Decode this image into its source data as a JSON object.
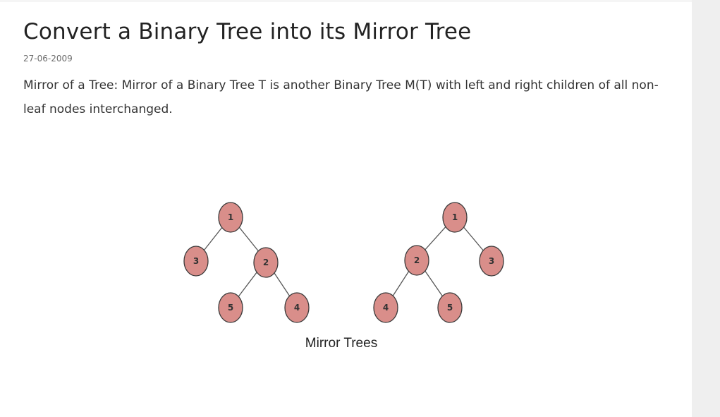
{
  "article": {
    "title": "Convert a Binary Tree into its Mirror Tree",
    "date": "27-06-2009",
    "description": "Mirror of a Tree: Mirror of a Binary Tree T is another Binary Tree M(T) with left and right children of all non-leaf nodes interchanged."
  },
  "figure": {
    "caption": "Mirror Trees",
    "node_color": "#d98e8a",
    "original_tree": {
      "root": "1",
      "left_child": "3",
      "right_child": "2",
      "right_left_child": "5",
      "right_right_child": "4"
    },
    "mirror_tree": {
      "root": "1",
      "left_child": "2",
      "right_child": "3",
      "left_left_child": "4",
      "left_right_child": "5"
    }
  }
}
